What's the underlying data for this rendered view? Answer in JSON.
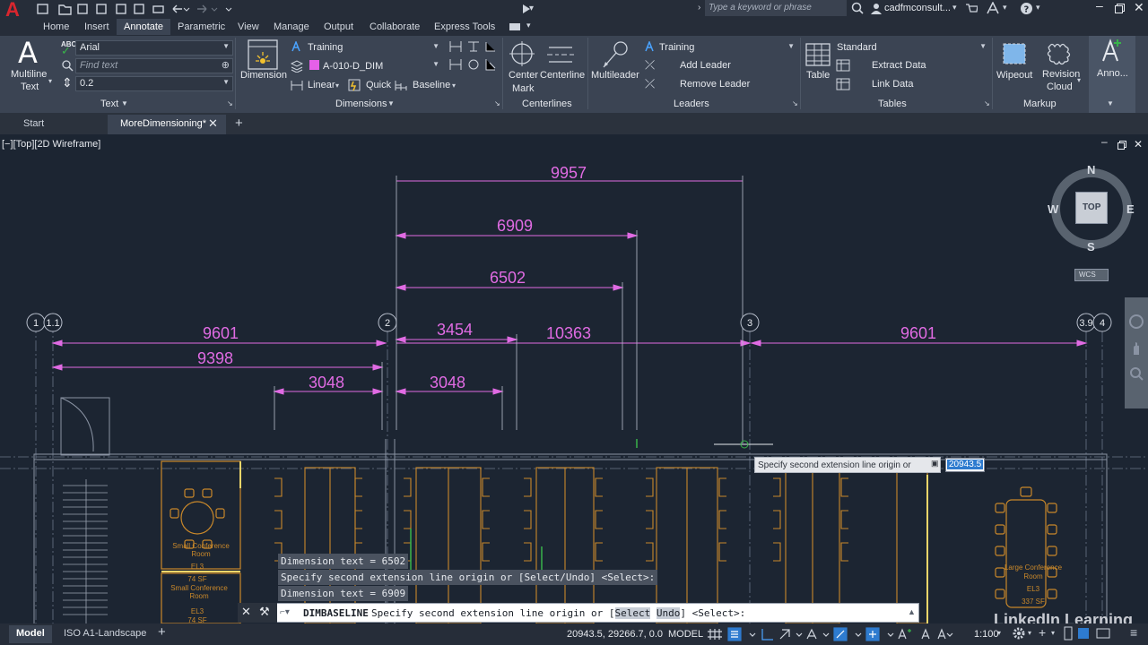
{
  "app": {
    "logo": "A",
    "search_placeholder": "Type a keyword or phrase",
    "user": "cadfmconsult..."
  },
  "menu_tabs": [
    "Home",
    "Insert",
    "Annotate",
    "Parametric",
    "View",
    "Manage",
    "Output",
    "Collaborate",
    "Express Tools"
  ],
  "ribbon": {
    "text_panel": {
      "multiline_text": "Multiline",
      "multiline_text2": "Text",
      "font": "Arial",
      "find_placeholder": "Find text",
      "height": "0.2",
      "title": "Text"
    },
    "dimensions_panel": {
      "dimension": "Dimension",
      "style": "Training",
      "layer": "A-010-D_DIM",
      "linear": "Linear",
      "quick": "Quick",
      "baseline": "Baseline",
      "title": "Dimensions"
    },
    "centerlines_panel": {
      "center_mark1": "Center",
      "center_mark2": "Mark",
      "centerline": "Centerline",
      "title": "Centerlines"
    },
    "leaders_panel": {
      "multileader": "Multileader",
      "style": "Training",
      "add_leader": "Add Leader",
      "remove_leader": "Remove Leader",
      "title": "Leaders"
    },
    "tables_panel": {
      "table": "Table",
      "style": "Standard",
      "extract_data": "Extract Data",
      "link_data": "Link Data",
      "title": "Tables"
    },
    "markup_panel": {
      "wipeout": "Wipeout",
      "revision1": "Revision",
      "revision2": "Cloud",
      "title": "Markup"
    },
    "anno_panel": {
      "label": "Anno..."
    }
  },
  "doc_tabs": {
    "start": "Start",
    "active": "MoreDimensioning*",
    "add": "+"
  },
  "viewport": {
    "label": "[−][Top][2D Wireframe]",
    "viewcube": {
      "top": "TOP",
      "n": "N",
      "s": "S",
      "e": "E",
      "w": "W",
      "wcs": "WCS"
    },
    "grid_bubbles": [
      "1",
      "1.1",
      "2",
      "3",
      "3.9",
      "4"
    ],
    "dims": {
      "d9957": "9957",
      "d6909": "6909",
      "d6502": "6502",
      "d9601a": "9601",
      "d3454": "3454",
      "d10363": "10363",
      "d9601b": "9601",
      "d9398": "9398",
      "d3048a": "3048",
      "d3048b": "3048"
    },
    "rooms": {
      "small1": "Small Conference",
      "small1b": "Room",
      "small1_tag": "EL3",
      "small2": "Small Conference",
      "small2b": "Room",
      "small2_tag": "EL3",
      "large": "Large Conference",
      "large_b": "Room",
      "large_tag": "EL3",
      "large_sf": "337 SF",
      "sf1": "74 SF",
      "sf2": "74 SF"
    },
    "tooltip": {
      "prompt": "Specify second extension line origin or",
      "value": "20943.5"
    },
    "history": [
      "Dimension text = 6502",
      "Specify second extension line origin or [Select/Undo] <Select>:",
      "Dimension text = 6909"
    ],
    "command": {
      "name": "DIMBASELINE",
      "prompt": "Specify second extension line origin or [",
      "opt1": "Select",
      "opt2": "Undo",
      "end": "] <Select>:"
    }
  },
  "status": {
    "model_tab": "Model",
    "layout_tab": "ISO A1-Landscape",
    "coords": "20943.5, 29266.7, 0.0",
    "model": "MODEL",
    "scale": "1:100"
  },
  "watermark": "LinkedIn Learning",
  "colors": {
    "dim": "#e06be3",
    "ribbon": "#3b4453",
    "accent": "#2e7bcf",
    "geometry": "#c9882a"
  }
}
